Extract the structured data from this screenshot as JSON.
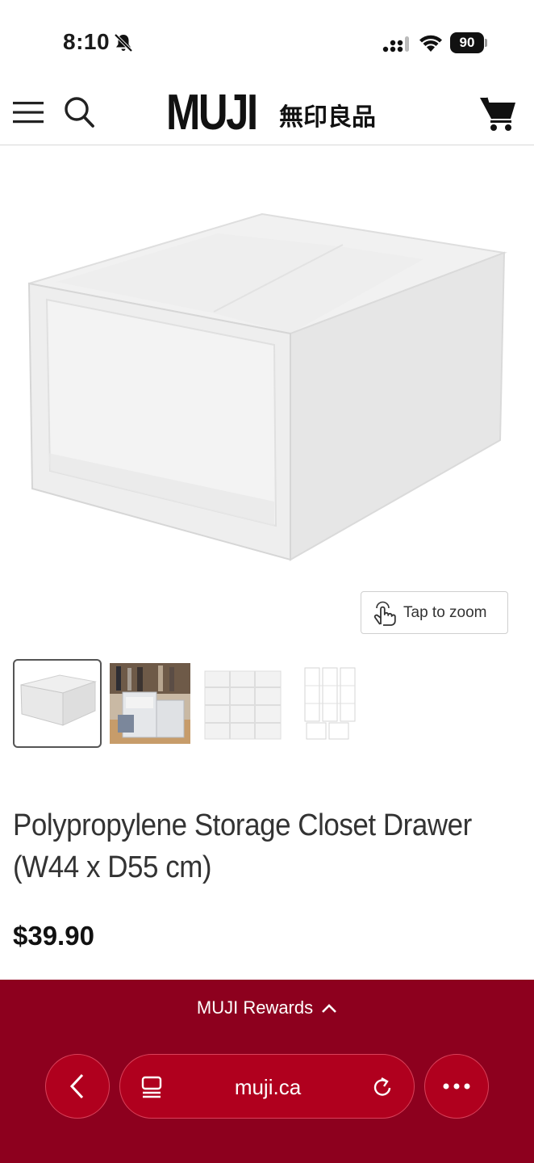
{
  "status_bar": {
    "time": "8:10",
    "battery": "90",
    "icons": [
      "bell-slash-icon",
      "signal-icon",
      "wifi-icon",
      "battery-icon"
    ]
  },
  "header": {
    "logo_text": "MUJI",
    "logo_kanji": "無印良品",
    "icons": [
      "menu-icon",
      "search-icon",
      "cart-icon"
    ]
  },
  "product": {
    "zoom_label": "Tap to zoom",
    "title": "Polypropylene Storage Closet Drawer (W44 x D55 cm)",
    "price": "$39.90",
    "thumbnail_count": 4
  },
  "browser_bar": {
    "rewards_label": "MUJI Rewards",
    "url": "muji.ca",
    "accent_color": "#8d001e"
  }
}
